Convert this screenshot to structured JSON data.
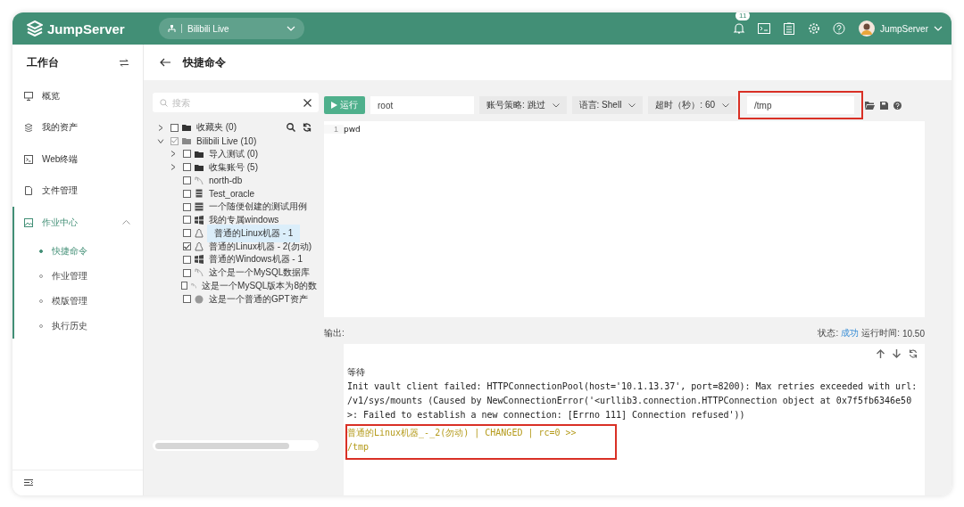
{
  "header": {
    "logo": "JumpServer",
    "org": "Bilibili Live",
    "notification_count": "11",
    "user": "JumpServer"
  },
  "sidebar": {
    "title": "工作台",
    "items": [
      {
        "label": "概览",
        "kind": "monitor",
        "selected": false
      },
      {
        "label": "我的资产",
        "kind": "layers",
        "selected": false
      },
      {
        "label": "Web终端",
        "kind": "terminal",
        "selected": false
      },
      {
        "label": "文件管理",
        "kind": "file",
        "selected": false
      },
      {
        "label": "作业中心",
        "kind": "image",
        "selected": true,
        "expanded": true,
        "children": [
          {
            "label": "快捷命令",
            "selected": true
          },
          {
            "label": "作业管理",
            "selected": false
          },
          {
            "label": "模版管理",
            "selected": false
          },
          {
            "label": "执行历史",
            "selected": false
          }
        ]
      }
    ]
  },
  "page": {
    "title": "快捷命令"
  },
  "tree": {
    "search_placeholder": "搜索",
    "nodes": [
      {
        "label": "收藏夹 (0)",
        "kind": "folder",
        "expanded": false,
        "checked": false,
        "indeterminate": false,
        "selected": false
      },
      {
        "label": "Bilibili Live (10)",
        "kind": "folder",
        "expanded": true,
        "checked": true,
        "indeterminate": true,
        "selected": false,
        "children": [
          {
            "label": "导入测试 (0)",
            "kind": "folder",
            "expanded": false,
            "checked": false,
            "indeterminate": false,
            "selected": false
          },
          {
            "label": "收集账号 (5)",
            "kind": "folder",
            "expanded": false,
            "checked": false,
            "indeterminate": false,
            "selected": false
          },
          {
            "label": "north-db",
            "kind": "database",
            "checked": false,
            "indeterminate": false,
            "selected": false
          },
          {
            "label": "Test_oracle",
            "kind": "storage",
            "checked": false,
            "indeterminate": false,
            "selected": false
          },
          {
            "label": "一个随便创建的测试用例",
            "kind": "server",
            "checked": false,
            "indeterminate": false,
            "selected": false
          },
          {
            "label": "我的专属windows",
            "kind": "windows",
            "checked": false,
            "indeterminate": false,
            "selected": false
          },
          {
            "label": "普通的Linux机器 - 1",
            "kind": "linux",
            "checked": false,
            "indeterminate": false,
            "selected": true
          },
          {
            "label": "普通的Linux机器 - 2(勿动)",
            "kind": "linux",
            "checked": true,
            "indeterminate": false,
            "selected": false
          },
          {
            "label": "普通的Windows机器 - 1",
            "kind": "windows",
            "checked": false,
            "indeterminate": false,
            "selected": false
          },
          {
            "label": "这个是一个MySQL数据库",
            "kind": "database",
            "checked": false,
            "indeterminate": false,
            "selected": false
          },
          {
            "label": "这是一个MySQL版本为8的数",
            "kind": "database",
            "checked": false,
            "indeterminate": false,
            "selected": false
          },
          {
            "label": "这是一个普通的GPT资产",
            "kind": "gpt",
            "checked": false,
            "indeterminate": false,
            "selected": false
          }
        ]
      }
    ]
  },
  "toolbar": {
    "run_button": "运行",
    "account": "root",
    "account_policy": "账号策略: 跳过",
    "language": "语言: Shell",
    "timeout": "超时（秒）: 60",
    "workdir": "/tmp",
    "workdir_highlighted": true
  },
  "editor": {
    "lines": [
      {
        "number": "1",
        "text": "pwd"
      }
    ]
  },
  "output": {
    "label": "输出:",
    "status_label": "状态:",
    "status": "成功",
    "time_label": "运行时间:",
    "time": "10.50",
    "blocks": [
      {
        "highlighted": false,
        "lines": [
          {
            "text": "等待"
          },
          {
            "text": "Init vault client failed: HTTPConnectionPool(host='10.1.13.37', port=8200): Max retries exceeded with url: /v1/sys/mounts (Caused by NewConnectionError('<urllib3.connection.HTTPConnection object at 0x7f5fb6346e50>: Failed to establish a new connection: [Errno 111] Connection refused'))"
          }
        ]
      },
      {
        "highlighted": true,
        "lines": [
          {
            "text": "普通的Linux机器_-_2(勿动) | CHANGED | rc=0 >>",
            "kind": "changed"
          },
          {
            "text": "/tmp",
            "kind": "changed"
          }
        ]
      }
    ]
  }
}
